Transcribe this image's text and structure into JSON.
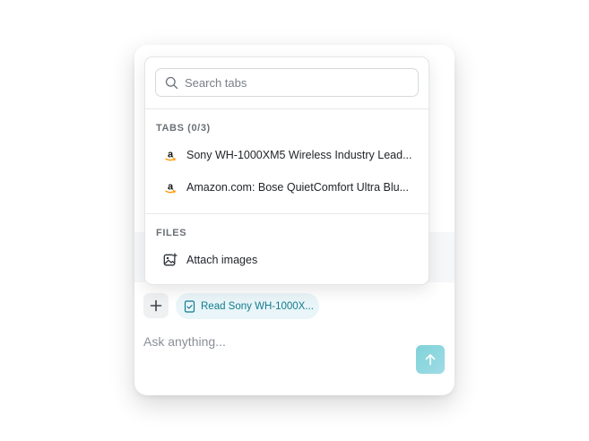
{
  "popover": {
    "search": {
      "placeholder": "Search tabs",
      "value": ""
    },
    "tabs_section": {
      "label": "TABS (0/3)",
      "items": [
        {
          "label": "Sony WH-1000XM5 Wireless Industry Lead...",
          "icon": "amazon-icon"
        },
        {
          "label": "Amazon.com: Bose QuietComfort Ultra Blu...",
          "icon": "amazon-icon"
        }
      ]
    },
    "files_section": {
      "label": "FILES",
      "items": [
        {
          "label": "Attach images",
          "icon": "image-plus-icon"
        }
      ]
    }
  },
  "composer": {
    "add_icon": "plus-icon",
    "chip": {
      "label": "Read Sony WH-1000X...",
      "icon": "page-check-icon"
    },
    "input": {
      "placeholder": "Ask anything...",
      "value": ""
    },
    "send_icon": "arrow-up-icon"
  },
  "colors": {
    "chip_bg": "#e9f5f8",
    "chip_text": "#137b8f",
    "send_button": "#8fd7df",
    "amazon_orange": "#ff9900"
  }
}
